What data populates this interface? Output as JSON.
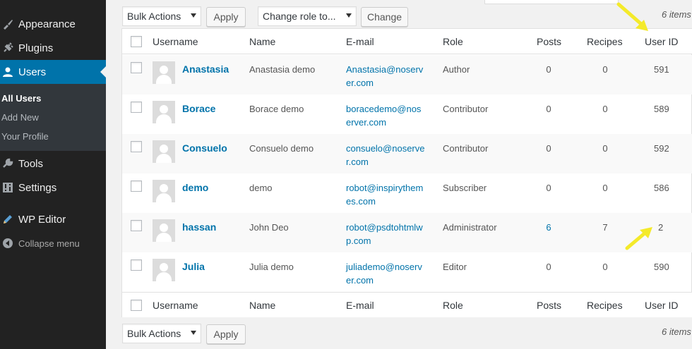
{
  "sidebar": {
    "items": [
      {
        "label": "Appearance",
        "icon": "paintbrush-icon"
      },
      {
        "label": "Plugins",
        "icon": "plugin-icon"
      },
      {
        "label": "Users",
        "icon": "users-icon"
      },
      {
        "label": "Tools",
        "icon": "wrench-icon"
      },
      {
        "label": "Settings",
        "icon": "settings-icon"
      },
      {
        "label": "WP Editor",
        "icon": "pencil-icon"
      }
    ],
    "submenu": [
      "All Users",
      "Add New",
      "Your Profile"
    ],
    "collapse_label": "Collapse menu"
  },
  "toolbar_top": {
    "bulk_actions": "Bulk Actions",
    "apply": "Apply",
    "change_role": "Change role to...",
    "change": "Change",
    "items_count": "6 items"
  },
  "toolbar_bottom": {
    "bulk_actions": "Bulk Actions",
    "apply": "Apply",
    "items_count": "6 items"
  },
  "table": {
    "columns": [
      "Username",
      "Name",
      "E-mail",
      "Role",
      "Posts",
      "Recipes",
      "User ID"
    ],
    "rows": [
      {
        "username": "Anastasia",
        "name": "Anastasia demo",
        "email": "Anastasia@noserver.com",
        "role": "Author",
        "posts": "0",
        "recipes": "0",
        "user_id": "591"
      },
      {
        "username": "Borace",
        "name": "Borace demo",
        "email": "boracedemo@noserver.com",
        "role": "Contributor",
        "posts": "0",
        "recipes": "0",
        "user_id": "589"
      },
      {
        "username": "Consuelo",
        "name": "Consuelo demo",
        "email": "consuelo@noserver.com",
        "role": "Contributor",
        "posts": "0",
        "recipes": "0",
        "user_id": "592"
      },
      {
        "username": "demo",
        "name": "demo",
        "email": "robot@inspirythemes.com",
        "role": "Subscriber",
        "posts": "0",
        "recipes": "0",
        "user_id": "586"
      },
      {
        "username": "hassan",
        "name": "John Deo",
        "email": "robot@psdtohtmlwp.com",
        "role": "Administrator",
        "posts": "6",
        "recipes": "7",
        "user_id": "2"
      },
      {
        "username": "Julia",
        "name": "Julia demo",
        "email": "juliademo@noserver.com",
        "role": "Editor",
        "posts": "0",
        "recipes": "0",
        "user_id": "590"
      }
    ]
  },
  "colors": {
    "accent": "#0073aa",
    "sidebar": "#222222",
    "highlight_arrow": "#f4ea2a"
  }
}
